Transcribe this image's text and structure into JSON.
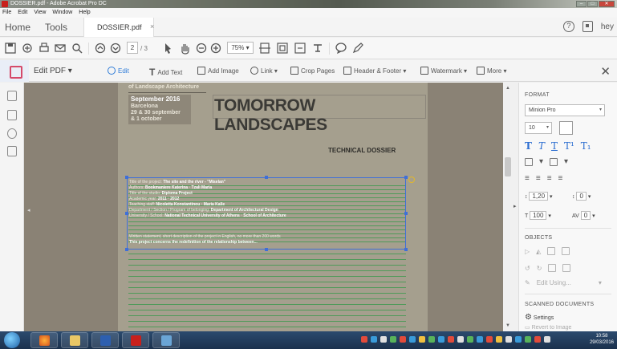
{
  "window": {
    "title": "DOSSIER.pdf - Adobe Acrobat Pro DC",
    "controls": [
      "–",
      "□",
      "✕"
    ]
  },
  "menubar": [
    "File",
    "Edit",
    "View",
    "Window",
    "Help"
  ],
  "tabs": {
    "home": "Home",
    "tools": "Tools",
    "document": "DOSSIER.pdf",
    "document_close": "×",
    "user": "hey",
    "help": "?"
  },
  "toolbar": {
    "page_current": "2",
    "page_total": "/ 3",
    "zoom": "75%"
  },
  "edit_toolbar": {
    "mode_label": "Edit PDF",
    "mode_chevron": "▾",
    "tools": [
      {
        "label": "Edit",
        "icon": "edit-icon",
        "active": true
      },
      {
        "label": "Add Text",
        "icon": "add-text-icon"
      },
      {
        "label": "Add Image",
        "icon": "add-image-icon"
      },
      {
        "label": "Link ▾",
        "icon": "link-icon"
      },
      {
        "label": "Crop Pages",
        "icon": "crop-icon"
      },
      {
        "label": "Header & Footer ▾",
        "icon": "header-footer-icon"
      },
      {
        "label": "Watermark ▾",
        "icon": "watermark-icon"
      },
      {
        "label": "More ▾",
        "icon": "more-icon"
      }
    ],
    "close": "✕"
  },
  "page": {
    "header_top": "of Landscape Architecture",
    "date_line1": "September 2016",
    "date_line2": "Barcelona\n29 & 30 september\n& 1 october",
    "title": "TOMORROW LANDSCAPES",
    "subtitle": "TECHNICAL DOSSIER",
    "fields": [
      {
        "label": "Title of the project:",
        "value": "The site and the river - \"Miselan\""
      },
      {
        "label": "Authors:",
        "value": "Bookmaniere Katerina · Tzali Maria"
      },
      {
        "label": "Title of the studio:",
        "value": "Diploma Project"
      },
      {
        "label": "Academic year:",
        "value": "2011 · 2012"
      },
      {
        "label": "Teaching staff:",
        "value": "Nicoletta Konstantinou · Maria Kalle"
      },
      {
        "label": "Department / Section / Program of belonging:",
        "value": "Department of Architectural Design"
      },
      {
        "label": "University / School:",
        "value": "National Technical University of Athens · School of Architecture"
      }
    ],
    "statement_label": "Written statement, short description of the project in English, no more than 200 words",
    "statement_value": "This project concerns the redefinition of the relationship between..."
  },
  "right_panel": {
    "format_heading": "FORMAT",
    "font": "Minion Pro",
    "font_size": "10",
    "line_spacing": "1,20",
    "para_spacing": "0",
    "scale": "100",
    "char_spacing": "0",
    "objects_heading": "OBJECTS",
    "edit_using": "Edit Using...",
    "scanned_heading": "SCANNED DOCUMENTS",
    "settings": "Settings",
    "revert": "Revert to Image"
  },
  "taskbar": {
    "time": "10:58",
    "date": "29/03/2016"
  },
  "colors": {
    "selection": "#3f6fd8",
    "form_lines": "#4f9a59",
    "accent": "#2d7bd8"
  }
}
